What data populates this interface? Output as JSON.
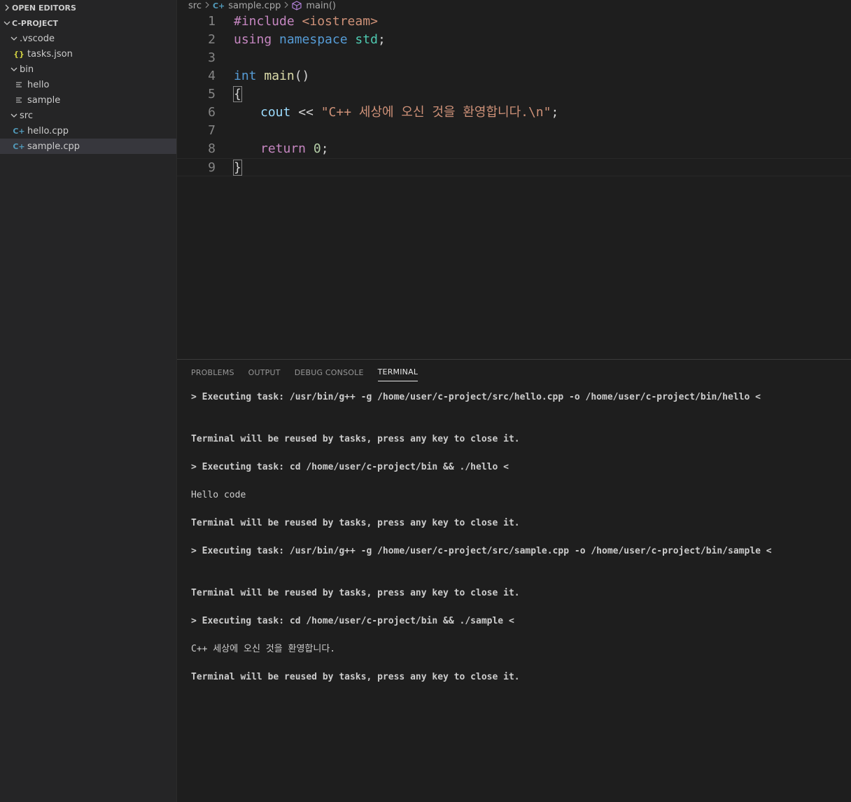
{
  "sidebar": {
    "open_editors": "OPEN EDITORS",
    "project": "C-PROJECT",
    "items": [
      {
        "label": ".vscode"
      },
      {
        "label": "tasks.json"
      },
      {
        "label": "bin"
      },
      {
        "label": "hello"
      },
      {
        "label": "sample"
      },
      {
        "label": "src"
      },
      {
        "label": "hello.cpp"
      },
      {
        "label": "sample.cpp"
      }
    ]
  },
  "breadcrumb": {
    "folder": "src",
    "file": "sample.cpp",
    "symbol": "main()"
  },
  "editor": {
    "line_numbers": [
      "1",
      "2",
      "3",
      "4",
      "5",
      "6",
      "7",
      "8",
      "9"
    ],
    "tokens": {
      "include": "#include",
      "header": " <iostream>",
      "using": "using",
      "namespace": "namespace",
      "std": "std",
      "semicolon": ";",
      "int_kw": "int",
      "main_fn": "main",
      "parens": "()",
      "open_brace": "{",
      "cout": "cout",
      "shift_op": " << ",
      "string_lit": "\"C++ 세상에 오신 것을 환영합니다.\\n\"",
      "return_kw": "return",
      "zero": "0",
      "close_brace": "}",
      "space": " "
    }
  },
  "panel": {
    "tabs": [
      "PROBLEMS",
      "OUTPUT",
      "DEBUG CONSOLE",
      "TERMINAL"
    ],
    "active_tab": "TERMINAL",
    "terminal_lines": [
      "> Executing task: /usr/bin/g++ -g /home/user/c-project/src/hello.cpp -o /home/user/c-project/bin/hello <",
      "",
      "",
      "Terminal will be reused by tasks, press any key to close it.",
      "",
      "> Executing task: cd /home/user/c-project/bin && ./hello <",
      "",
      "Hello code",
      "",
      "Terminal will be reused by tasks, press any key to close it.",
      "",
      "> Executing task: /usr/bin/g++ -g /home/user/c-project/src/sample.cpp -o /home/user/c-project/bin/sample <",
      "",
      "",
      "Terminal will be reused by tasks, press any key to close it.",
      "",
      "> Executing task: cd /home/user/c-project/bin && ./sample <",
      "",
      "C++ 세상에 오신 것을 환영합니다.",
      "",
      "Terminal will be reused by tasks, press any key to close it."
    ]
  }
}
